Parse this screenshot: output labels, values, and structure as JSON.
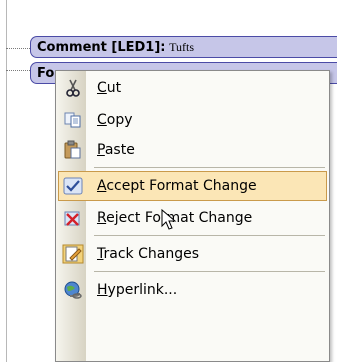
{
  "balloons": [
    {
      "title": "Comment [LED1]:",
      "value": "Tufts"
    },
    {
      "title": "Fo",
      "value": ""
    }
  ],
  "menu": {
    "items": [
      {
        "key": "cut",
        "label": "Cut",
        "icon": "scissors-icon"
      },
      {
        "key": "copy",
        "label": "Copy",
        "icon": "copy-icon"
      },
      {
        "key": "paste",
        "label": "Paste",
        "icon": "paste-icon"
      },
      {
        "key": "accept",
        "label": "Accept Format Change",
        "icon": "accept-change-icon",
        "selected": true
      },
      {
        "key": "reject",
        "label": "Reject Format Change",
        "icon": "reject-change-icon"
      },
      {
        "key": "track",
        "label": "Track Changes",
        "icon": "track-changes-icon"
      },
      {
        "key": "link",
        "label": "Hyperlink...",
        "icon": "hyperlink-icon"
      }
    ]
  },
  "colors": {
    "balloon_fill": "#c6c6e8",
    "balloon_border": "#4b4ba6",
    "menu_highlight": "#fbe6b6",
    "menu_highlight_border": "#c99a4b"
  }
}
